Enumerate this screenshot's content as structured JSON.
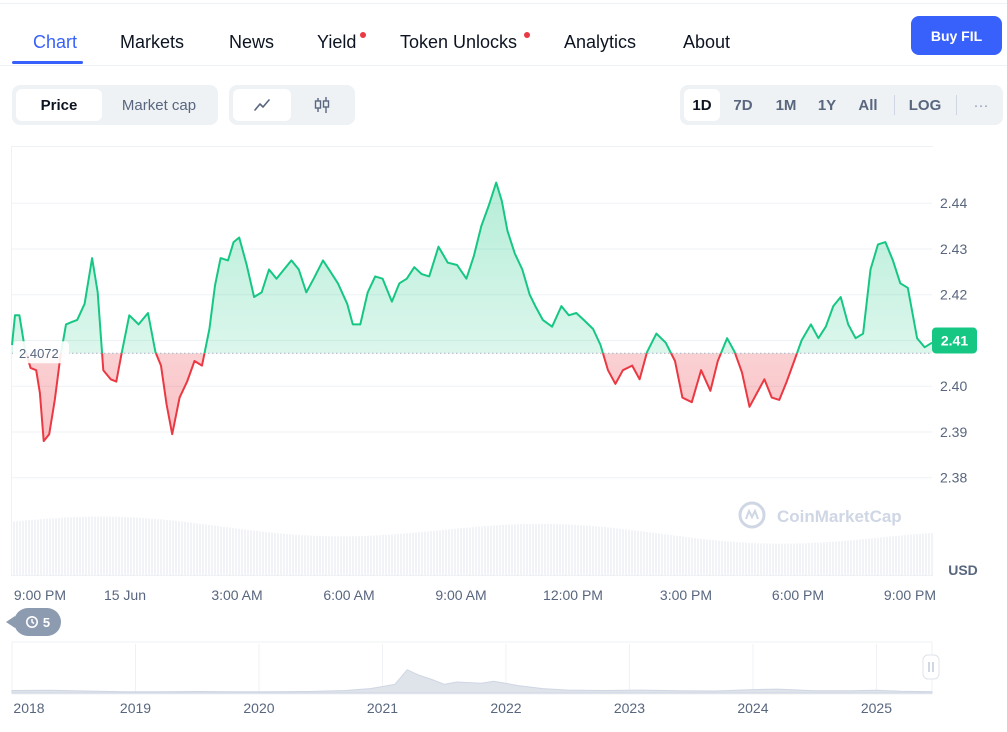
{
  "nav": {
    "tabs": [
      {
        "label": "Chart",
        "active": true,
        "dot": false
      },
      {
        "label": "Markets",
        "active": false,
        "dot": false
      },
      {
        "label": "News",
        "active": false,
        "dot": false
      },
      {
        "label": "Yield",
        "active": false,
        "dot": true
      },
      {
        "label": "Token Unlocks",
        "active": false,
        "dot": true
      },
      {
        "label": "Analytics",
        "active": false,
        "dot": false
      },
      {
        "label": "About",
        "active": false,
        "dot": false
      }
    ],
    "buy_label": "Buy FIL"
  },
  "toggles": {
    "metric": [
      "Price",
      "Market cap"
    ],
    "metric_selected": "Price",
    "chart_type_icons": [
      "line-chart-icon",
      "candlestick-icon"
    ],
    "ranges": [
      "1D",
      "7D",
      "1M",
      "1Y",
      "All",
      "LOG"
    ],
    "range_selected": "1D",
    "more": "···"
  },
  "colors": {
    "accent": "#3861fb",
    "up": "#16c784",
    "down": "#ea3943"
  },
  "history_badge": "5",
  "chart_data": {
    "type": "area",
    "title": "",
    "currency": "USD",
    "baseline": 2.4072,
    "baseline_label": "2.4072",
    "current_label": "2.41",
    "ylim": [
      2.3725,
      2.4525
    ],
    "yticks": [
      2.44,
      2.43,
      2.42,
      2.41,
      2.4,
      2.39,
      2.38
    ],
    "ytick_labels": [
      "2.44",
      "2.43",
      "2.42",
      "2.41",
      "2.40",
      "2.39",
      "2.38"
    ],
    "xticks": [
      {
        "label": "9:00 PM",
        "h": 0
      },
      {
        "label": "15 Jun",
        "h": 3
      },
      {
        "label": "3:00 AM",
        "h": 6
      },
      {
        "label": "6:00 AM",
        "h": 9
      },
      {
        "label": "9:00 AM",
        "h": 12
      },
      {
        "label": "12:00 PM",
        "h": 15
      },
      {
        "label": "3:00 PM",
        "h": 18
      },
      {
        "label": "6:00 PM",
        "h": 21
      },
      {
        "label": "9:00 PM",
        "h": 24
      }
    ],
    "series": [
      {
        "points": [
          [
            0,
            2.409
          ],
          [
            0.08,
            2.4155
          ],
          [
            0.2,
            2.4155
          ],
          [
            0.35,
            2.408
          ],
          [
            0.5,
            2.404
          ],
          [
            0.65,
            2.4035
          ],
          [
            0.75,
            2.3985
          ],
          [
            0.85,
            2.388
          ],
          [
            1.0,
            2.3895
          ],
          [
            1.15,
            2.397
          ],
          [
            1.3,
            2.4065
          ],
          [
            1.45,
            2.4135
          ],
          [
            1.6,
            2.414
          ],
          [
            1.75,
            2.4145
          ],
          [
            1.95,
            2.418
          ],
          [
            2.15,
            2.428
          ],
          [
            2.3,
            2.4205
          ],
          [
            2.45,
            2.4035
          ],
          [
            2.65,
            2.4015
          ],
          [
            2.8,
            2.401
          ],
          [
            2.95,
            2.4075
          ],
          [
            3.15,
            2.4155
          ],
          [
            3.4,
            2.4135
          ],
          [
            3.65,
            2.416
          ],
          [
            3.85,
            2.4075
          ],
          [
            4.0,
            2.4045
          ],
          [
            4.15,
            2.396
          ],
          [
            4.3,
            2.3895
          ],
          [
            4.5,
            2.3975
          ],
          [
            4.7,
            2.401
          ],
          [
            4.9,
            2.4055
          ],
          [
            5.1,
            2.4045
          ],
          [
            5.3,
            2.4125
          ],
          [
            5.45,
            2.422
          ],
          [
            5.6,
            2.428
          ],
          [
            5.8,
            2.4275
          ],
          [
            5.95,
            2.4315
          ],
          [
            6.1,
            2.4325
          ],
          [
            6.3,
            2.4265
          ],
          [
            6.5,
            2.4195
          ],
          [
            6.7,
            2.4205
          ],
          [
            6.9,
            2.4255
          ],
          [
            7.1,
            2.4235
          ],
          [
            7.35,
            2.426
          ],
          [
            7.5,
            2.4275
          ],
          [
            7.7,
            2.4255
          ],
          [
            7.9,
            2.4205
          ],
          [
            8.1,
            2.4235
          ],
          [
            8.35,
            2.4275
          ],
          [
            8.55,
            2.425
          ],
          [
            8.75,
            2.4225
          ],
          [
            9.0,
            2.418
          ],
          [
            9.15,
            2.4135
          ],
          [
            9.35,
            2.4135
          ],
          [
            9.55,
            2.4205
          ],
          [
            9.75,
            2.424
          ],
          [
            9.95,
            2.4235
          ],
          [
            10.2,
            2.4185
          ],
          [
            10.4,
            2.4225
          ],
          [
            10.6,
            2.4235
          ],
          [
            10.8,
            2.426
          ],
          [
            11.0,
            2.4245
          ],
          [
            11.2,
            2.424
          ],
          [
            11.45,
            2.4305
          ],
          [
            11.7,
            2.427
          ],
          [
            11.95,
            2.4265
          ],
          [
            12.2,
            2.4235
          ],
          [
            12.4,
            2.4285
          ],
          [
            12.6,
            2.435
          ],
          [
            12.8,
            2.4395
          ],
          [
            13.0,
            2.4445
          ],
          [
            13.15,
            2.4405
          ],
          [
            13.3,
            2.434
          ],
          [
            13.5,
            2.429
          ],
          [
            13.7,
            2.4255
          ],
          [
            13.9,
            2.42
          ],
          [
            14.05,
            2.4175
          ],
          [
            14.25,
            2.4145
          ],
          [
            14.5,
            2.413
          ],
          [
            14.75,
            2.4175
          ],
          [
            14.95,
            2.4155
          ],
          [
            15.15,
            2.416
          ],
          [
            15.35,
            2.4145
          ],
          [
            15.6,
            2.4125
          ],
          [
            15.8,
            2.409
          ],
          [
            16.0,
            2.4035
          ],
          [
            16.2,
            2.4005
          ],
          [
            16.4,
            2.4035
          ],
          [
            16.65,
            2.4045
          ],
          [
            16.85,
            2.4015
          ],
          [
            17.05,
            2.4075
          ],
          [
            17.3,
            2.4115
          ],
          [
            17.55,
            2.4095
          ],
          [
            17.8,
            2.4055
          ],
          [
            18.0,
            2.3975
          ],
          [
            18.25,
            2.3965
          ],
          [
            18.5,
            2.4035
          ],
          [
            18.75,
            2.399
          ],
          [
            18.95,
            2.4055
          ],
          [
            19.2,
            2.4105
          ],
          [
            19.4,
            2.4075
          ],
          [
            19.6,
            2.403
          ],
          [
            19.8,
            2.3955
          ],
          [
            20.0,
            2.3985
          ],
          [
            20.2,
            2.4015
          ],
          [
            20.4,
            2.3975
          ],
          [
            20.6,
            2.397
          ],
          [
            20.8,
            2.401
          ],
          [
            21.0,
            2.4055
          ],
          [
            21.2,
            2.41
          ],
          [
            21.45,
            2.4135
          ],
          [
            21.65,
            2.4105
          ],
          [
            21.85,
            2.413
          ],
          [
            22.05,
            2.4175
          ],
          [
            22.25,
            2.4195
          ],
          [
            22.45,
            2.4135
          ],
          [
            22.65,
            2.4105
          ],
          [
            22.85,
            2.4115
          ],
          [
            23.05,
            2.4255
          ],
          [
            23.25,
            2.431
          ],
          [
            23.45,
            2.4315
          ],
          [
            23.65,
            2.4275
          ],
          [
            23.85,
            2.4225
          ],
          [
            24.05,
            2.4215
          ],
          [
            24.3,
            2.4105
          ],
          [
            24.5,
            2.4085
          ],
          [
            24.7,
            2.4095
          ]
        ]
      }
    ],
    "volume_note": "",
    "navigator": {
      "year_labels": [
        "2018",
        "2019",
        "2020",
        "2021",
        "2022",
        "2023",
        "2024",
        "2025"
      ],
      "years": [
        2018,
        2019,
        2020,
        2021,
        2022,
        2023,
        2024,
        2025
      ],
      "range": [
        2018.0,
        2025.45
      ],
      "points": [
        [
          2018.0,
          0.1
        ],
        [
          2018.3,
          0.11
        ],
        [
          2018.6,
          0.08
        ],
        [
          2018.9,
          0.05
        ],
        [
          2019.2,
          0.05
        ],
        [
          2019.5,
          0.06
        ],
        [
          2019.8,
          0.05
        ],
        [
          2020.1,
          0.05
        ],
        [
          2020.4,
          0.06
        ],
        [
          2020.7,
          0.1
        ],
        [
          2020.9,
          0.18
        ],
        [
          2021.1,
          0.35
        ],
        [
          2021.2,
          0.95
        ],
        [
          2021.3,
          0.72
        ],
        [
          2021.4,
          0.55
        ],
        [
          2021.5,
          0.35
        ],
        [
          2021.6,
          0.45
        ],
        [
          2021.8,
          0.4
        ],
        [
          2021.9,
          0.48
        ],
        [
          2022.1,
          0.3
        ],
        [
          2022.3,
          0.18
        ],
        [
          2022.5,
          0.12
        ],
        [
          2022.8,
          0.1
        ],
        [
          2023.1,
          0.12
        ],
        [
          2023.4,
          0.09
        ],
        [
          2023.7,
          0.08
        ],
        [
          2024.0,
          0.14
        ],
        [
          2024.2,
          0.16
        ],
        [
          2024.5,
          0.09
        ],
        [
          2024.8,
          0.09
        ],
        [
          2025.0,
          0.11
        ],
        [
          2025.2,
          0.07
        ],
        [
          2025.45,
          0.05
        ]
      ]
    }
  }
}
